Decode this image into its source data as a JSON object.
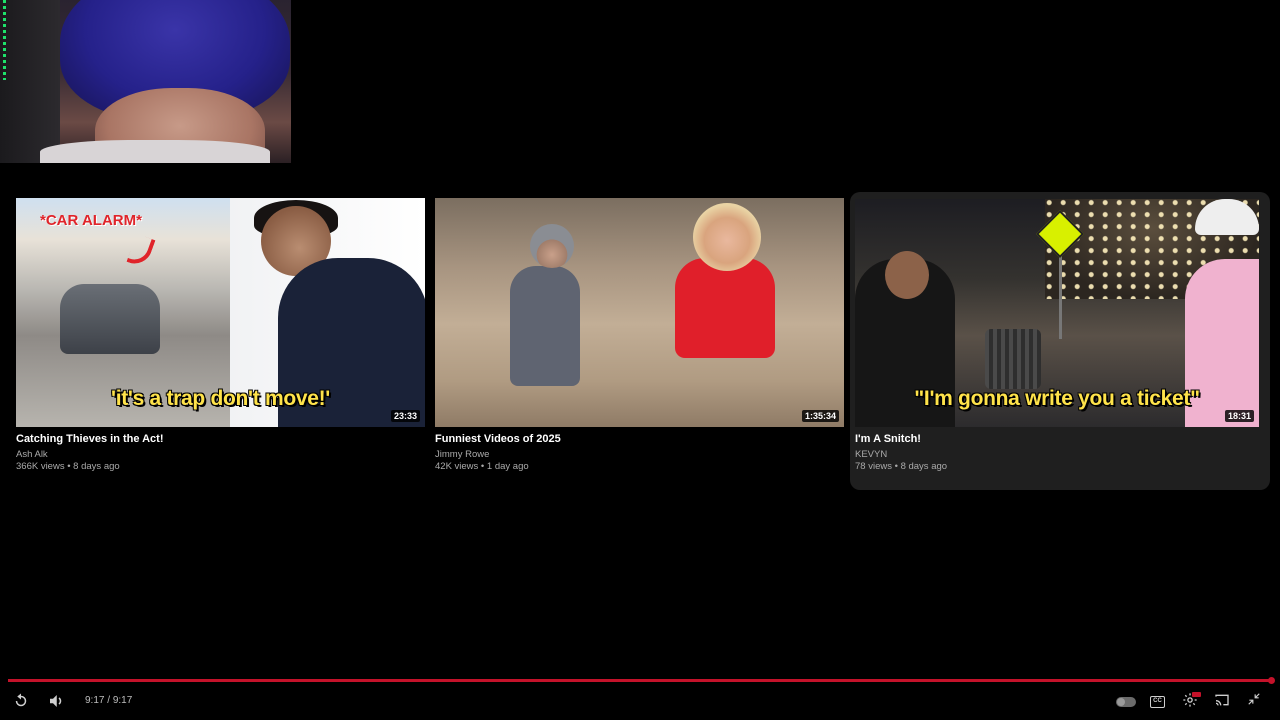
{
  "end_screen": {
    "videos": [
      {
        "title": "Catching Thieves in the Act!",
        "channel": "Ash Alk",
        "stats": "366K views • 8 days ago",
        "duration": "23:33",
        "thumb_caption": "'it's a trap don't move!'",
        "thumb_tag": "*CAR ALARM*"
      },
      {
        "title": "Funniest Videos of 2025",
        "channel": "Jimmy Rowe",
        "stats": "42K views • 1 day ago",
        "duration": "1:35:34"
      },
      {
        "title": "I'm A Snitch!",
        "channel": "KEVYN",
        "stats": "78 views • 8 days ago",
        "duration": "18:31",
        "thumb_caption": "\"I'm gonna write you a ticket\""
      }
    ]
  },
  "player": {
    "time_current": "9:17",
    "time_separator": " / ",
    "time_total": "9:17",
    "progress": 1.0,
    "accent_color": "#c4122a",
    "icons": {
      "replay": "replay-icon",
      "volume": "volume-icon",
      "autoplay": "autoplay-toggle",
      "captions": "captions-icon",
      "settings": "settings-icon",
      "cast": "cast-icon",
      "exit_fullscreen": "exit-fullscreen-icon"
    }
  }
}
